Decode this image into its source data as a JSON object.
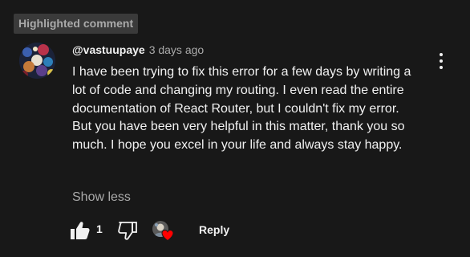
{
  "badge": {
    "label": "Highlighted comment"
  },
  "comment": {
    "author": "@vastuupaye",
    "time": "3 days ago",
    "text": "I have been trying to fix this error for a few days by writing a lot of code and changing my routing. I even read the entire documentation of React Router, but I couldn't fix my error. But you have been very helpful in this matter, thank you so much. I hope you excel in your life and always stay happy.",
    "show_less": "Show less"
  },
  "actions": {
    "like_count": "1",
    "reply_label": "Reply"
  },
  "icons": {
    "menu": "more-vert-icon",
    "like": "thumbs-up-icon",
    "dislike": "thumbs-down-icon",
    "heart": "heart-icon"
  },
  "colors": {
    "background": "#181818",
    "primary_text": "#f1f1f1",
    "secondary_text": "#aaaaaa",
    "badge_bg": "#3a3a3a",
    "heart": "#ff0000"
  }
}
